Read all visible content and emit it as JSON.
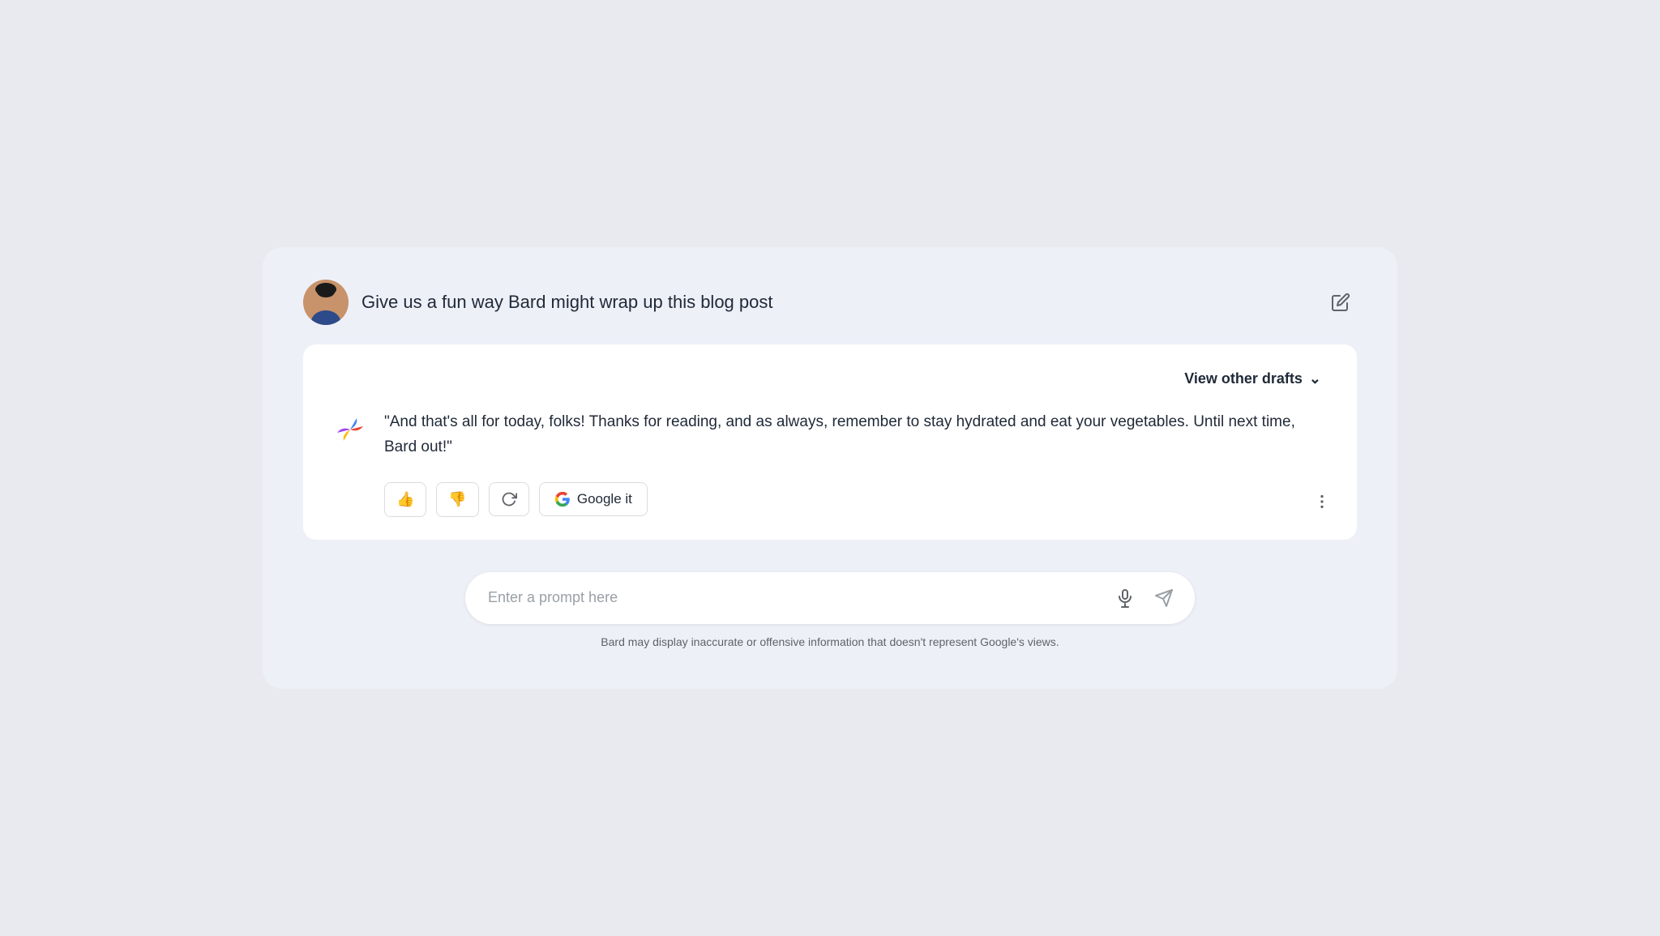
{
  "page": {
    "background": "#e8eaf0",
    "card_background": "#ffffff",
    "container_background": "#eef0f8"
  },
  "user_prompt": {
    "text": "Give us a fun way Bard might wrap up this blog post",
    "avatar_alt": "User avatar"
  },
  "toolbar": {
    "edit_label": "Edit"
  },
  "response_section": {
    "view_other_drafts_label": "View other drafts",
    "response_text": "\"And that's all for today, folks! Thanks for reading, and as always, remember to stay hydrated and eat your vegetables. Until next time, Bard out!\""
  },
  "action_buttons": {
    "thumbs_up_label": "Good response",
    "thumbs_down_label": "Bad response",
    "refresh_label": "Refresh",
    "google_it_label": "Google it",
    "more_options_label": "More options"
  },
  "input": {
    "placeholder": "Enter a prompt here"
  },
  "disclaimer": {
    "text": "Bard may display inaccurate or offensive information that doesn't represent Google's views."
  }
}
